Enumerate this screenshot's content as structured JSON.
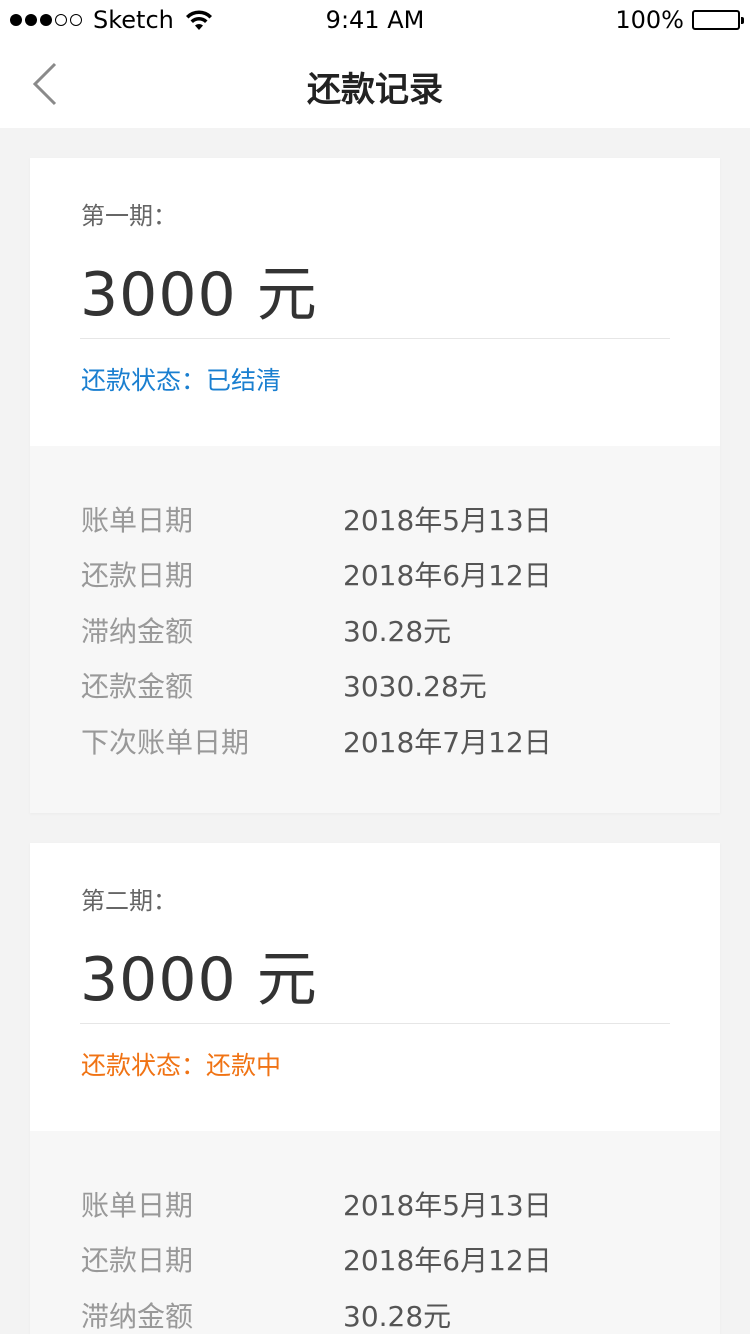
{
  "status_bar": {
    "carrier": "Sketch",
    "time": "9:41 AM",
    "battery": "100%"
  },
  "nav": {
    "title": "还款记录"
  },
  "colors": {
    "settled": "#1a7fd0",
    "in_progress": "#f07314"
  },
  "records": [
    {
      "period": "第一期：",
      "amount": "3000 元",
      "status_label": "还款状态：",
      "status_value": "已结清",
      "details": [
        {
          "label": "账单日期",
          "value": "2018年5月13日"
        },
        {
          "label": "还款日期",
          "value": "2018年6月12日"
        },
        {
          "label": "滞纳金额",
          "value": "30.28元"
        },
        {
          "label": "还款金额",
          "value": "3030.28元"
        },
        {
          "label": "下次账单日期",
          "value": "2018年7月12日"
        }
      ]
    },
    {
      "period": "第二期：",
      "amount": "3000 元",
      "status_label": "还款状态：",
      "status_value": "还款中",
      "details": [
        {
          "label": "账单日期",
          "value": "2018年5月13日"
        },
        {
          "label": "还款日期",
          "value": "2018年6月12日"
        },
        {
          "label": "滞纳金额",
          "value": "30.28元"
        }
      ]
    }
  ]
}
